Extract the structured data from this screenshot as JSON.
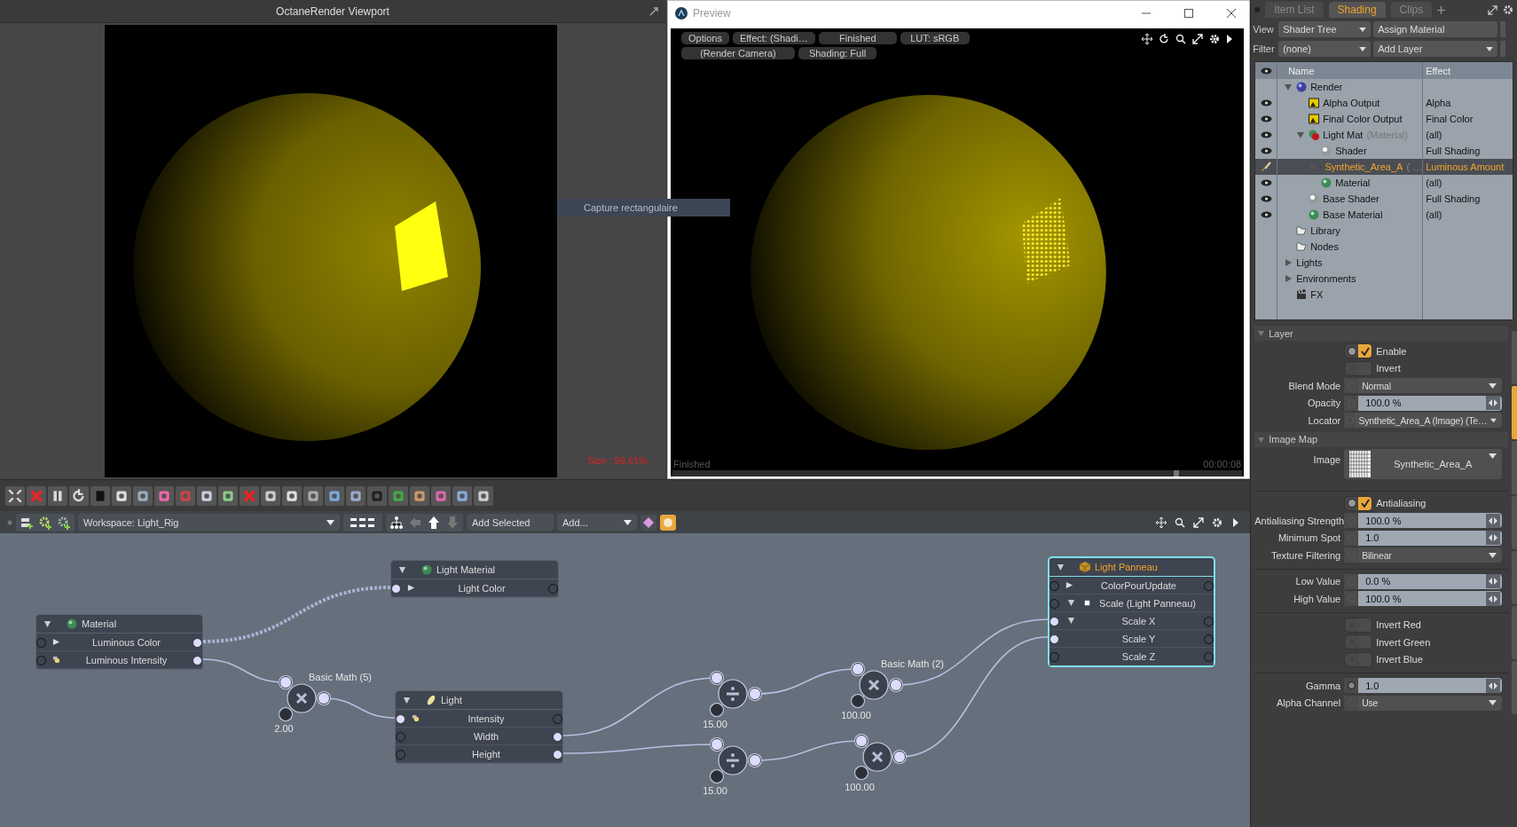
{
  "viewport": {
    "title": "OctaneRender Viewport",
    "size_readout": "Size : 99.61%",
    "tooltip": "Capture rectangulaire"
  },
  "preview": {
    "title": "Preview",
    "pills_top": [
      "Options",
      "Effect: (Shadi…",
      "Finished",
      "LUT: sRGB"
    ],
    "pills_bottom": [
      "(Render Camera)",
      "Shading: Full"
    ],
    "status": "Finished",
    "time": "00:00:08"
  },
  "node_bar": {
    "workspace": "Workspace: Light_Rig",
    "add_selected": "Add Selected",
    "add": "Add..."
  },
  "nodes": [
    {
      "title": "Light Material",
      "kind": "material",
      "selected": false,
      "rows": [
        {
          "label": "Light Color",
          "kind": "color"
        }
      ]
    },
    {
      "title": "Material",
      "kind": "material",
      "selected": false,
      "rows": [
        {
          "label": "Luminous Color",
          "kind": "color"
        },
        {
          "label": "Luminous Intensity",
          "kind": "light"
        }
      ]
    },
    {
      "title": "Light",
      "kind": "light",
      "selected": false,
      "rows": [
        {
          "label": "Intensity",
          "kind": "light"
        },
        {
          "label": "Width",
          "kind": "plain"
        },
        {
          "label": "Height",
          "kind": "plain"
        }
      ]
    },
    {
      "title": "Light Panneau",
      "kind": "item",
      "selected": true,
      "rows": [
        {
          "label": "ColorPourUpdate",
          "kind": "color"
        },
        {
          "label": "Scale (Light Panneau)",
          "kind": "group",
          "expanded": true
        },
        {
          "label": "Scale X",
          "kind": "plain",
          "expanded": true
        },
        {
          "label": "Scale Y",
          "kind": "plain"
        },
        {
          "label": "Scale Z",
          "kind": "plain"
        }
      ]
    }
  ],
  "math_nodes": [
    {
      "kind": "multiply",
      "label": "Basic Math (5)",
      "value": "2.00"
    },
    {
      "kind": "divide",
      "value": "15.00"
    },
    {
      "kind": "multiply",
      "label": "Basic Math (2)",
      "value": "100.00"
    },
    {
      "kind": "divide",
      "value": "15.00"
    },
    {
      "kind": "multiply",
      "value": "100.00"
    }
  ],
  "shader_tree": {
    "tabs": [
      {
        "label": "Item List",
        "selected": false
      },
      {
        "label": "Shading",
        "selected": true
      },
      {
        "label": "Clips",
        "selected": false
      }
    ],
    "view_label": "View",
    "view": "Shader Tree",
    "assign": "Assign Material",
    "filter_label": "Filter",
    "filter": "(none)",
    "add_layer": "Add Layer",
    "columns": [
      "Name",
      "Effect"
    ],
    "items": [
      {
        "name": "Render",
        "kind": "render",
        "visible": false,
        "selected": false,
        "expanded": true,
        "children": [
          {
            "name": "Alpha Output",
            "kind": "output",
            "effect": "Alpha",
            "visible": true,
            "selected": false
          },
          {
            "name": "Final Color Output",
            "kind": "output",
            "effect": "Final Color",
            "visible": true,
            "selected": false
          },
          {
            "name": "Light Mat",
            "note": "(Material)",
            "kind": "mask",
            "effect": "(all)",
            "visible": true,
            "selected": false,
            "expanded": true,
            "children": [
              {
                "name": "Shader",
                "kind": "shader",
                "effect": "Full Shading",
                "visible": true,
                "selected": false
              },
              {
                "name": "Synthetic_Area_A",
                "note": "( …",
                "kind": "texture",
                "effect": "Luminous Amount",
                "selected": true,
                "expanded": false
              },
              {
                "name": "Material",
                "kind": "material",
                "effect": "(all)",
                "visible": true,
                "selected": false
              }
            ]
          },
          {
            "name": "Base Shader",
            "kind": "shader",
            "effect": "Full Shading",
            "visible": true,
            "selected": false
          },
          {
            "name": "Base Material",
            "kind": "material",
            "effect": "(all)",
            "visible": true,
            "selected": false
          }
        ]
      },
      {
        "name": "Library",
        "kind": "folder",
        "visible": false,
        "selected": false
      },
      {
        "name": "Nodes",
        "kind": "folder",
        "visible": false,
        "selected": false
      },
      {
        "name": "Lights",
        "kind": "group",
        "visible": false,
        "selected": false,
        "expanded": false
      },
      {
        "name": "Environments",
        "kind": "group",
        "visible": false,
        "selected": false,
        "expanded": false
      },
      {
        "name": "FX",
        "kind": "fx",
        "visible": false,
        "selected": false
      }
    ]
  },
  "side_tabs": [
    {
      "selected": false
    },
    {
      "selected": true
    },
    {
      "selected": false
    },
    {
      "selected": false
    },
    {
      "selected": false
    },
    {
      "selected": false
    },
    {
      "selected": false
    }
  ],
  "properties": [
    {
      "header": "Layer",
      "rows": [
        {
          "kind": "checkbox",
          "label": "Enable",
          "checked": true
        },
        {
          "kind": "checkbox",
          "label": "Invert",
          "checked": false
        },
        {
          "kind": "dropdown",
          "label": "Blend Mode",
          "value": "Normal"
        },
        {
          "kind": "number",
          "label": "Opacity",
          "value": "100.0 %"
        },
        {
          "kind": "dropdown",
          "label": "Locator",
          "value": "Synthetic_Area_A (Image) (Te…"
        }
      ]
    },
    {
      "header": "Image Map",
      "rows": [
        {
          "kind": "image",
          "label": "Image",
          "value": "Synthetic_Area_A"
        }
      ]
    },
    {
      "rows": [
        {
          "kind": "checkbox",
          "label": "Antialiasing",
          "checked": true
        },
        {
          "kind": "number",
          "label": "Antialiasing Strength",
          "value": "100.0 %"
        },
        {
          "kind": "number",
          "label": "Minimum Spot",
          "value": "1.0"
        },
        {
          "kind": "dropdown",
          "label": "Texture Filtering",
          "value": "Bilinear"
        }
      ]
    },
    {
      "rows": [
        {
          "kind": "number",
          "label": "Low Value",
          "value": "0.0 %"
        },
        {
          "kind": "number",
          "label": "High Value",
          "value": "100.0 %"
        }
      ]
    },
    {
      "rows": [
        {
          "kind": "checkbox",
          "label": "Invert Red",
          "checked": false
        },
        {
          "kind": "checkbox",
          "label": "Invert Green",
          "checked": false
        },
        {
          "kind": "checkbox",
          "label": "Invert Blue",
          "checked": false
        }
      ]
    },
    {
      "rows": [
        {
          "kind": "number",
          "label": "Gamma",
          "value": "1.0"
        },
        {
          "kind": "dropdown",
          "label": "Alpha Channel",
          "value": "Use"
        }
      ]
    }
  ]
}
